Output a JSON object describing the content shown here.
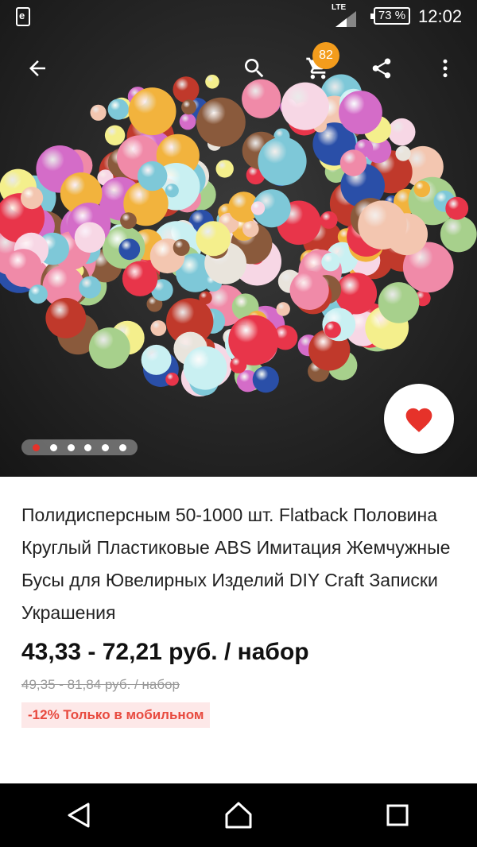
{
  "status_bar": {
    "network": "LTE",
    "battery": "73 %",
    "time": "12:02"
  },
  "toolbar": {
    "icons": [
      "back-arrow-icon",
      "search-icon",
      "cart-icon",
      "share-icon",
      "more-vert-icon"
    ],
    "cart_count": "82"
  },
  "gallery": {
    "image_count": 6,
    "active_index": 0
  },
  "product": {
    "title": "Полидисперсным 50-1000 шт. Flatback Половина Круглый Пластиковые ABS Имитация Жемчужные Бусы для Ювелирных Изделий DIY Craft Записки Украшения",
    "price": "43,33 - 72,21 руб. / набор",
    "old_price": "49,35 - 81,84 руб. / набор",
    "promo": "-12% Только в мобильном"
  },
  "colors": {
    "accent": "#e6322a",
    "badge": "#f39c1c",
    "promo_bg": "#fde8e8",
    "promo_text": "#e84a3f"
  }
}
